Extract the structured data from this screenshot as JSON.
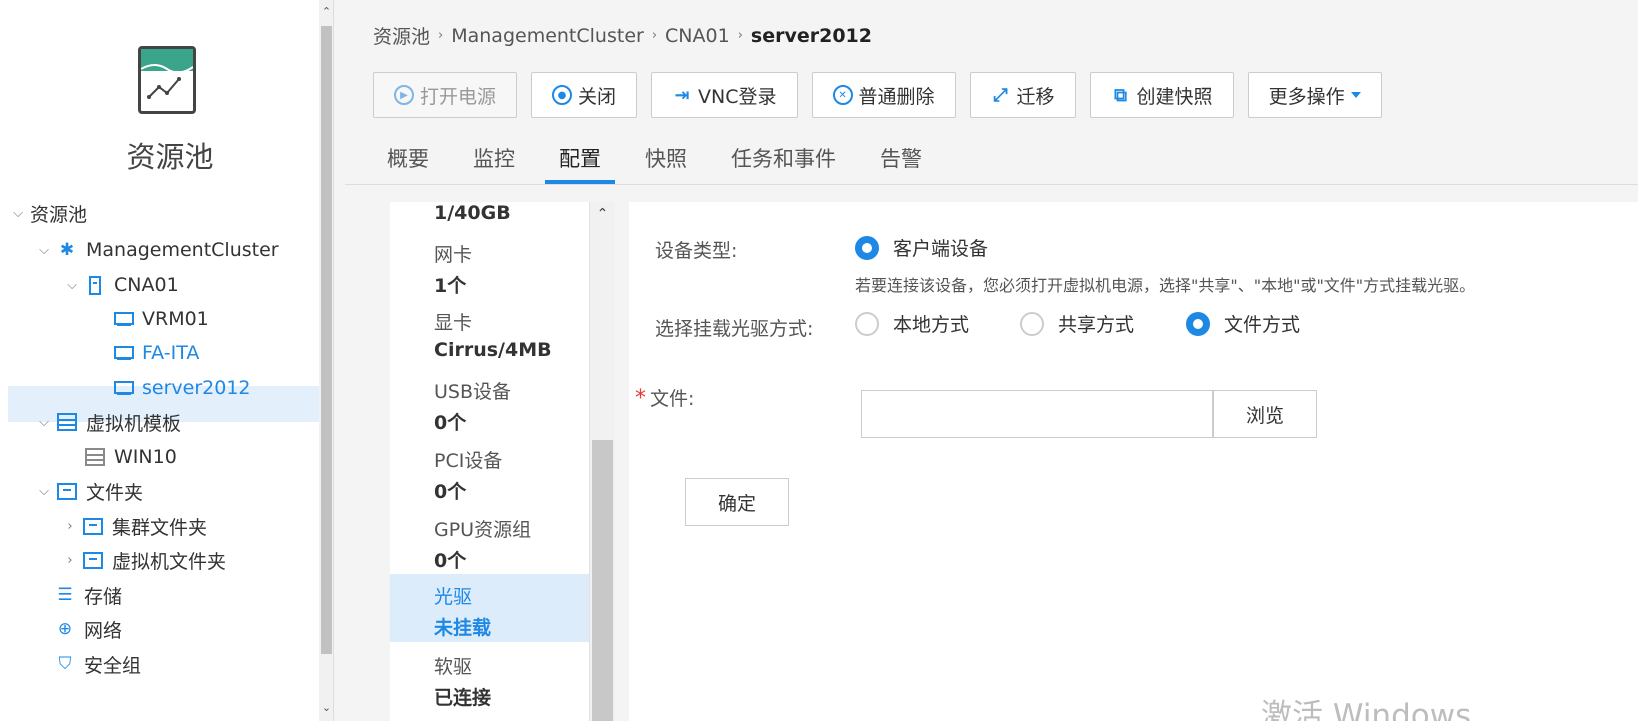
{
  "nav": {
    "title": "资源池",
    "tree": [
      {
        "label": "资源池"
      },
      {
        "label": "ManagementCluster"
      },
      {
        "label": "CNA01"
      },
      {
        "label": "VRM01"
      },
      {
        "label": "FA-ITA"
      },
      {
        "label": "server2012"
      },
      {
        "label": "虚拟机模板"
      },
      {
        "label": "WIN10"
      },
      {
        "label": "文件夹"
      },
      {
        "label": "集群文件夹"
      },
      {
        "label": "虚拟机文件夹"
      },
      {
        "label": "存储"
      },
      {
        "label": "网络"
      },
      {
        "label": "安全组"
      }
    ]
  },
  "breadcrumb": {
    "items": [
      "资源池",
      "ManagementCluster",
      "CNA01"
    ],
    "current": "server2012"
  },
  "toolbar": {
    "power_on": "打开电源",
    "shutdown": "关闭",
    "vnc": "VNC登录",
    "delete": "普通删除",
    "migrate": "迁移",
    "snapshot": "创建快照",
    "more": "更多操作"
  },
  "tabs": [
    "概要",
    "监控",
    "配置",
    "快照",
    "任务和事件",
    "告警"
  ],
  "config_list": {
    "top_value": "1/40GB",
    "items": [
      {
        "label": "网卡",
        "value": "1个"
      },
      {
        "label": "显卡",
        "value": "Cirrus/4MB"
      },
      {
        "label": "USB设备",
        "value": "0个"
      },
      {
        "label": "PCI设备",
        "value": "0个"
      },
      {
        "label": "GPU资源组",
        "value": "0个"
      },
      {
        "label": "光驱",
        "value": "未挂载"
      },
      {
        "label": "软驱",
        "value": "已连接"
      }
    ]
  },
  "form": {
    "device_type_label": "设备类型:",
    "device_type_option": "客户端设备",
    "hint": "若要连接该设备，您必须打开虚拟机电源，选择\"共享\"、\"本地\"或\"文件\"方式挂载光驱。",
    "mount_mode_label": "选择挂载光驱方式:",
    "mount_options": [
      "本地方式",
      "共享方式",
      "文件方式"
    ],
    "file_label": "文件:",
    "file_value": "",
    "browse_label": "浏览",
    "ok_label": "确定"
  },
  "watermark": "激活 Windows",
  "colors": {
    "accent": "#1e88e5",
    "selected_bg": "#e3f0fb",
    "required": "#e53935"
  }
}
